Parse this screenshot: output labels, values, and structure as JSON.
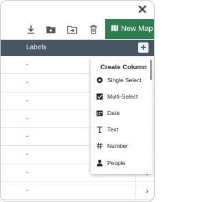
{
  "toolbar": {
    "new_map_label": "New Map"
  },
  "header": {
    "labels_col": "Labels"
  },
  "rows": [
    {
      "value": "-"
    },
    {
      "value": "-"
    },
    {
      "value": "-"
    },
    {
      "value": "-"
    },
    {
      "value": "-"
    },
    {
      "value": "-"
    },
    {
      "value": "-"
    },
    {
      "value": "-"
    }
  ],
  "menu": {
    "title": "Create Column",
    "items": [
      {
        "label": "Single Select",
        "icon": "radio-icon"
      },
      {
        "label": "Multi-Select",
        "icon": "checkbox-icon"
      },
      {
        "label": "Date",
        "icon": "calendar-icon"
      },
      {
        "label": "Text",
        "icon": "text-icon"
      },
      {
        "label": "Number",
        "icon": "hash-icon"
      },
      {
        "label": "People",
        "icon": "person-icon"
      }
    ]
  },
  "colors": {
    "accent": "#2e7d4f",
    "header_bg": "#485663"
  }
}
